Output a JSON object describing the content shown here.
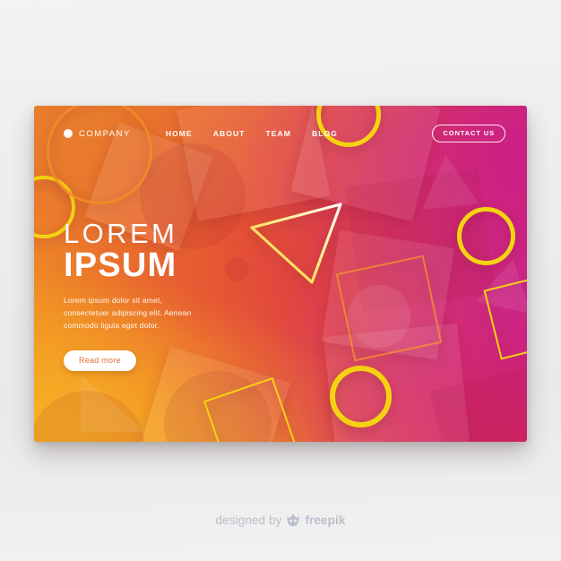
{
  "page": {
    "background_color": "#ececed",
    "card": {
      "gradient_from": "#f5a623",
      "gradient_mid": "#e0453f",
      "gradient_to": "#c81f92"
    },
    "accent_yellow": "#f5d311"
  },
  "nav": {
    "brand_dot_icon": "circle-dot-icon",
    "brand": "COMPANY",
    "links": [
      {
        "label": "HOME"
      },
      {
        "label": "ABOUT"
      },
      {
        "label": "TEAM"
      },
      {
        "label": "BLOG"
      }
    ],
    "cta": "CONTACT US"
  },
  "hero": {
    "title_light": "LOREM",
    "title_bold": "IPSUM",
    "paragraph": "Lorem ipsum dolor sit amet, consectetuer adipiscing elit. Aenean commodo ligula eget dolor.",
    "button": "Read more"
  },
  "credit": {
    "prefix": "designed by",
    "logo_icon": "freepik-crown-face-icon",
    "brand": "freepik"
  }
}
